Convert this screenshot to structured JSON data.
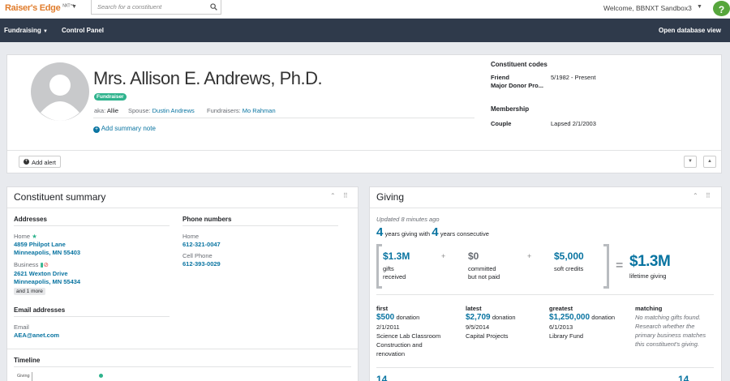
{
  "topbar": {
    "logo": "Raiser's Edge",
    "logo_suffix": "NXT™",
    "search_placeholder": "Search for a constituent",
    "welcome": "Welcome, BBNXT Sandbox3",
    "help": "?"
  },
  "nav": {
    "fundraising": "Fundraising",
    "control_panel": "Control Panel",
    "open_db": "Open database view"
  },
  "profile": {
    "name": "Mrs. Allison E. Andrews, Ph.D.",
    "badge": "Fundraiser",
    "aka_label": "aka:",
    "aka_value": "Allie",
    "spouse_label": "Spouse:",
    "spouse_value": "Dustin Andrews",
    "fundraisers_label": "Fundraisers:",
    "fundraisers_value": "Mo Rahman",
    "add_note": "Add summary note",
    "codes_title": "Constituent codes",
    "codes": [
      {
        "name": "Friend",
        "value": "5/1982 - Present"
      },
      {
        "name": "Major Donor Pro...",
        "value": ""
      }
    ],
    "membership_title": "Membership",
    "membership": {
      "name": "Couple",
      "value": "Lapsed 2/1/2003"
    },
    "add_alert": "Add alert"
  },
  "summary": {
    "title": "Constituent summary",
    "addresses_title": "Addresses",
    "home_label": "Home",
    "home_line1": "4859 Philpot Lane",
    "home_line2": "Minneapolis, MN 55403",
    "business_label": "Business",
    "business_line1": "2621 Wexton Drive",
    "business_line2": "Minneapolis, MN 55434",
    "more": "and 1 more",
    "phones_title": "Phone numbers",
    "phone_home_label": "Home",
    "phone_home": "612-321-0047",
    "phone_cell_label": "Cell Phone",
    "phone_cell": "612-393-0029",
    "email_title": "Email addresses",
    "email_label": "Email",
    "email": "AEA@anet.com",
    "timeline_title": "Timeline",
    "timeline_axis": "Giving"
  },
  "giving": {
    "title": "Giving",
    "updated": "Updated 8 minutes ago",
    "years": "4",
    "years_label": "years giving with",
    "consecutive": "4",
    "consecutive_label": "years consecutive",
    "gifts_amount": "$1.3M",
    "gifts_l1": "gifts",
    "gifts_l2": "received",
    "plus1": "+",
    "committed_amount": "$0",
    "committed_l1": "committed",
    "committed_l2": "but not paid",
    "plus2": "+",
    "soft_amount": "$5,000",
    "soft_l1": "soft credits",
    "equals": "=",
    "lifetime_amount": "$1.3M",
    "lifetime_label": "lifetime giving",
    "first": {
      "label": "first",
      "amount": "$500",
      "type": "donation",
      "date": "2/1/2011",
      "fund_l1": "Science Lab Classroom",
      "fund_l2": "Construction and",
      "fund_l3": "renovation"
    },
    "latest": {
      "label": "latest",
      "amount": "$2,709",
      "type": "donation",
      "date": "9/5/2014",
      "fund_l1": "Capital Projects"
    },
    "greatest": {
      "label": "greatest",
      "amount": "$1,250,000",
      "type": "donation",
      "date": "6/1/2013",
      "fund_l1": "Library Fund"
    },
    "matching": {
      "label": "matching",
      "l1": "No matching gifts found.",
      "l2": "Research whether the",
      "l3": "primary business matches",
      "l4": "this constituent's giving."
    },
    "bottom_left": "14",
    "bottom_right": "14"
  },
  "colors": {
    "brand_orange": "#e07c2c",
    "nav_bg": "#2f3a4b",
    "link_blue": "#0974a1",
    "badge_green": "#2fb38d",
    "help_green": "#56a63c"
  }
}
